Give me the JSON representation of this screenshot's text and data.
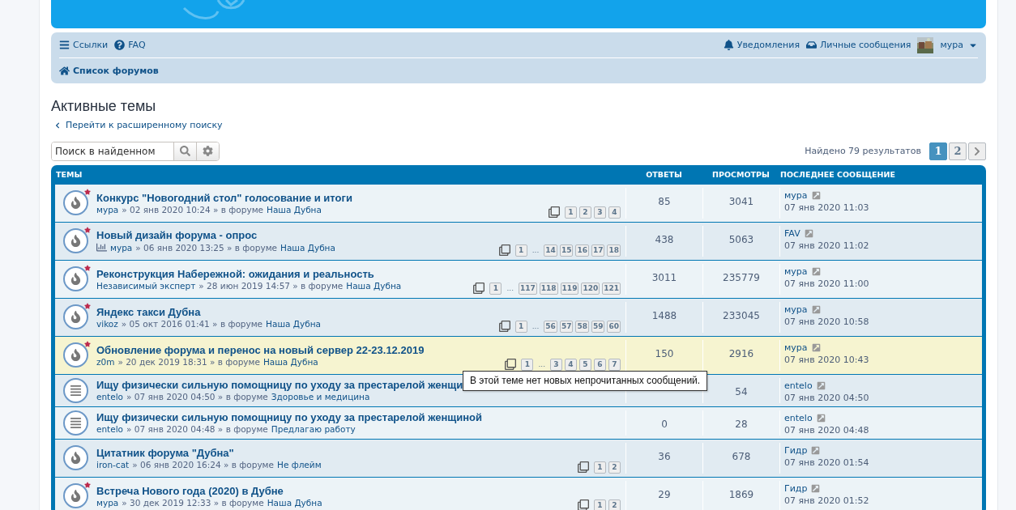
{
  "navbar": {
    "links": [
      {
        "kind": "menu",
        "label": "Ссылки"
      },
      {
        "kind": "help",
        "label": "FAQ"
      }
    ],
    "user_links": [
      {
        "kind": "bell",
        "label": "Уведомления"
      },
      {
        "kind": "inbox",
        "label": "Личные сообщения"
      }
    ],
    "user": {
      "name": "мура"
    },
    "breadcrumb": "Список форумов"
  },
  "page_title": "Активные темы",
  "back_link": "Перейти к расширенному поиску",
  "search": {
    "placeholder": "Поиск в найденном"
  },
  "pagination": {
    "summary": "Найдено 79 результатов",
    "pages": [
      {
        "label": "1",
        "selected": true
      },
      {
        "label": "2",
        "selected": false
      }
    ]
  },
  "table": {
    "columns": [
      "ТЕМЫ",
      "ОТВЕТЫ",
      "ПРОСМОТРЫ",
      "ПОСЛЕДНЕЕ СООБЩЕНИЕ"
    ],
    "rows": [
      {
        "kind": "hot",
        "unread": true,
        "poll": false,
        "highlighted": false,
        "title": "Конкурс \"Новогодний стол\" голосование и итоги",
        "author": "мура",
        "date": "» 02 янв 2020 10:24 » в форуме",
        "forum": "Наша Дубна",
        "pages": [
          {
            "kind": "page",
            "label": "1"
          },
          {
            "kind": "page",
            "label": "2"
          },
          {
            "kind": "page",
            "label": "3"
          },
          {
            "kind": "page",
            "label": "4"
          }
        ],
        "replies": "85",
        "views": "3041",
        "last_author": "мура",
        "last_date": "07 янв 2020 11:03"
      },
      {
        "kind": "hot",
        "unread": true,
        "poll": true,
        "highlighted": false,
        "title": "Новый дизайн форума - опрос",
        "author": "мура",
        "date": "» 06 янв 2020 13:25 » в форуме",
        "forum": "Наша Дубна",
        "pages": [
          {
            "kind": "page",
            "label": "1"
          },
          {
            "kind": "gap",
            "label": "..."
          },
          {
            "kind": "page",
            "label": "14"
          },
          {
            "kind": "page",
            "label": "15"
          },
          {
            "kind": "page",
            "label": "16"
          },
          {
            "kind": "page",
            "label": "17"
          },
          {
            "kind": "page",
            "label": "18"
          }
        ],
        "replies": "438",
        "views": "5063",
        "last_author": "FAV",
        "last_date": "07 янв 2020 11:02"
      },
      {
        "kind": "hot",
        "unread": true,
        "poll": false,
        "highlighted": false,
        "title": "Реконструкция Набережной: ожидания и реальность",
        "author": "Независимый эксперт",
        "date": "» 28 июн 2019 14:57 » в форуме",
        "forum": "Наша Дубна",
        "pages": [
          {
            "kind": "page",
            "label": "1"
          },
          {
            "kind": "gap",
            "label": "..."
          },
          {
            "kind": "page",
            "label": "117"
          },
          {
            "kind": "page",
            "label": "118"
          },
          {
            "kind": "page",
            "label": "119"
          },
          {
            "kind": "page",
            "label": "120"
          },
          {
            "kind": "page",
            "label": "121"
          }
        ],
        "replies": "3011",
        "views": "235779",
        "last_author": "мура",
        "last_date": "07 янв 2020 11:00"
      },
      {
        "kind": "hot",
        "unread": true,
        "poll": false,
        "highlighted": false,
        "title": "Яндекс такси Дубна",
        "author": "vikoz",
        "date": "» 05 окт 2016 01:41 » в форуме",
        "forum": "Наша Дубна",
        "pages": [
          {
            "kind": "page",
            "label": "1"
          },
          {
            "kind": "gap",
            "label": "..."
          },
          {
            "kind": "page",
            "label": "56"
          },
          {
            "kind": "page",
            "label": "57"
          },
          {
            "kind": "page",
            "label": "58"
          },
          {
            "kind": "page",
            "label": "59"
          },
          {
            "kind": "page",
            "label": "60"
          }
        ],
        "replies": "1488",
        "views": "233045",
        "last_author": "мура",
        "last_date": "07 янв 2020 10:58"
      },
      {
        "kind": "hot",
        "unread": true,
        "poll": false,
        "highlighted": true,
        "title": "Обновление форума и перенос на новый сервер 22-23.12.2019",
        "author": "z0m",
        "date": "» 20 дек 2019 18:31 » в форуме",
        "forum": "Наша Дубна",
        "pages": [
          {
            "kind": "page",
            "label": "1"
          },
          {
            "kind": "gap",
            "label": "..."
          },
          {
            "kind": "page",
            "label": "3"
          },
          {
            "kind": "page",
            "label": "4"
          },
          {
            "kind": "page",
            "label": "5"
          },
          {
            "kind": "page",
            "label": "6"
          },
          {
            "kind": "page",
            "label": "7"
          }
        ],
        "replies": "150",
        "views": "2916",
        "last_author": "мура",
        "last_date": "07 янв 2020 10:43"
      },
      {
        "kind": "topic",
        "unread": false,
        "poll": false,
        "highlighted": false,
        "title": "Ищу физически сильную помощницу по уходу за престарелой женщи",
        "author": "entelo",
        "date": "» 07 янв 2020 04:50 » в форуме",
        "forum": "Здоровье и медицина",
        "views": "54",
        "last_author": "entelo",
        "last_date": "07 янв 2020 04:50"
      },
      {
        "kind": "topic",
        "unread": false,
        "poll": false,
        "highlighted": false,
        "title": "Ищу физически сильную помощницу по уходу за престарелой женщиной",
        "author": "entelo",
        "date": "» 07 янв 2020 04:48 » в форуме",
        "forum": "Предлагаю работу",
        "replies": "0",
        "views": "28",
        "last_author": "entelo",
        "last_date": "07 янв 2020 04:48"
      },
      {
        "kind": "hot",
        "unread": false,
        "poll": false,
        "highlighted": false,
        "title": "Цитатник форума \"Дубна\"",
        "author": "iron-cat",
        "date": "» 06 янв 2020 16:24 » в форуме",
        "forum": "Не флейм",
        "pages": [
          {
            "kind": "page",
            "label": "1"
          },
          {
            "kind": "page",
            "label": "2"
          }
        ],
        "replies": "36",
        "views": "678",
        "last_author": "Гидр",
        "last_date": "07 янв 2020 01:54"
      },
      {
        "kind": "hot",
        "unread": true,
        "poll": false,
        "highlighted": false,
        "title": "Встреча Нового года (2020) в Дубне",
        "author": "мура",
        "date": "» 30 дек 2019 12:33 » в форуме",
        "forum": "Наша Дубна",
        "pages": [
          {
            "kind": "page",
            "label": "1"
          },
          {
            "kind": "page",
            "label": "2"
          }
        ],
        "replies": "29",
        "views": "1869",
        "last_author": "Гидр",
        "last_date": "07 янв 2020 01:52"
      }
    ]
  },
  "tooltip": {
    "text": "В этой теме нет новых непрочитанных сообщений."
  }
}
